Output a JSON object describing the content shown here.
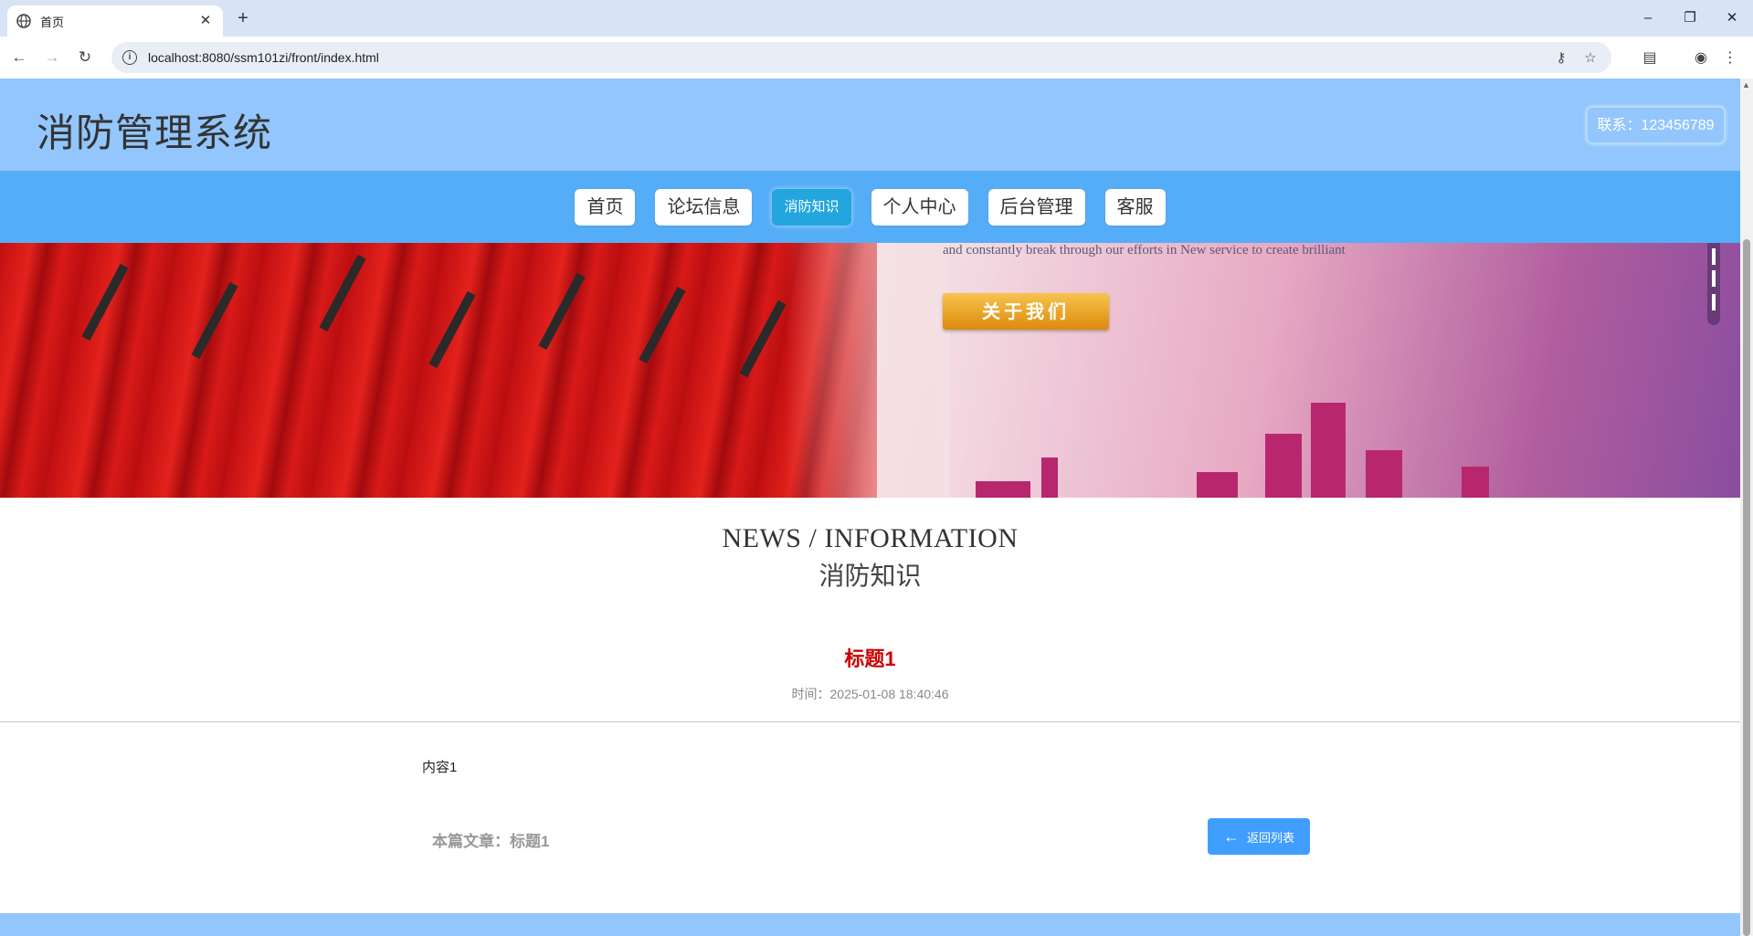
{
  "browser": {
    "tab_title": "首页",
    "url": "localhost:8080/ssm101zi/front/index.html",
    "new_tab": "+",
    "close_tab": "✕",
    "minimize": "–",
    "restore": "❐",
    "close_window": "✕"
  },
  "site": {
    "title": "消防管理系统",
    "contact": "联系：123456789"
  },
  "nav": {
    "items": [
      "首页",
      "论坛信息",
      "消防知识",
      "个人中心",
      "后台管理",
      "客服"
    ],
    "active": "消防知识"
  },
  "banner": {
    "tagline": "and constantly break through our efforts in New service to create brilliant",
    "about_button": "关于我们"
  },
  "section": {
    "title_en": "NEWS / INFORMATION",
    "title_cn": "消防知识"
  },
  "article": {
    "title": "标题1",
    "time": "时间：2025-01-08 18:40:46",
    "content": "内容1",
    "current_label": "本篇文章：标题1",
    "back_button": "返回列表"
  },
  "colors": {
    "header_bg": "#93c6fc",
    "nav_bg": "#55adf7",
    "active_nav": "#23a6dd",
    "article_title": "#cc0000",
    "primary_button": "#409eff"
  }
}
